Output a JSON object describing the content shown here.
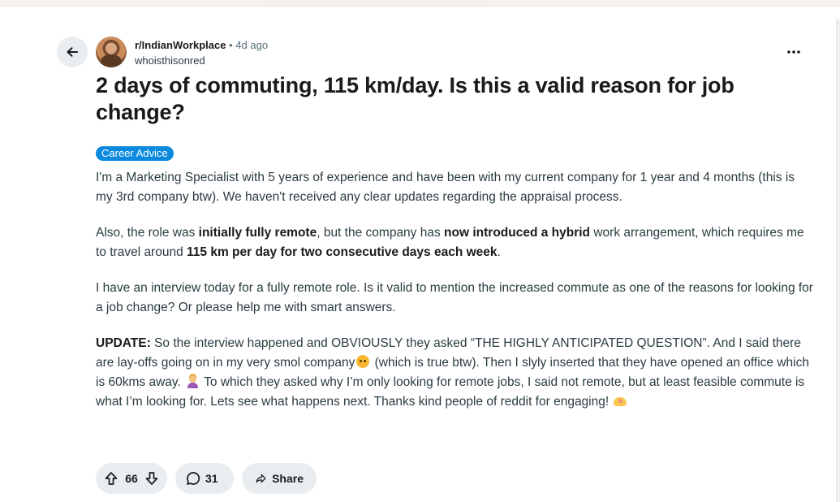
{
  "post": {
    "subreddit": "r/IndianWorkplace",
    "separator": "•",
    "time": "4d ago",
    "author": "whoisthisonred",
    "title": "2 days of commuting, 115 km/day. Is this a valid reason for job change?",
    "flair": "Career Advice",
    "paragraph1": "I'm a Marketing Specialist with 5 years of experience and have been with my current company for 1 year and 4 months (this is my 3rd company btw). We haven't received any clear updates regarding the appraisal process.",
    "paragraph2": {
      "t1": "Also, the role was ",
      "b1": "initially fully remote",
      "t2": ", but the company has ",
      "b2": "now introduced a hybrid",
      "t3": " work arrangement, which requires me to travel around ",
      "b3": "115 km per day for two consecutive days each week",
      "t4": "."
    },
    "paragraph3": "I have an interview today for a fully remote role. Is it valid to mention the increased commute as one of the reasons for looking for a job change? Or please help me with smart answers.",
    "paragraph4": {
      "label": "UPDATE:",
      "t1": " So the interview happened and OBVIOUSLY they asked “THE HIGHLY ANTICIPATED QUESTION”. And I said there are lay-offs going on in my very smol company",
      "t2": " (which is true btw). Then I slyly inserted that they have opened an office which is 60kms away.",
      "t3": " To which they asked why I’m only looking for remote jobs, I said not remote, but at least feasible commute is what I’m looking for. Lets see what happens next. Thanks kind people of reddit for engaging!"
    }
  },
  "actions": {
    "upvotes": "66",
    "comments": "31",
    "share_label": "Share"
  },
  "icons": {
    "back": "arrow-left-icon",
    "more": "more-horizontal-icon",
    "upvote": "arrow-up-icon",
    "downvote": "arrow-down-icon",
    "comment": "speech-bubble-icon",
    "share": "share-arrow-icon"
  },
  "colors": {
    "flair_bg": "#0a8adf",
    "pill_bg": "#e9edf0",
    "text": "#1a1a1b",
    "meta": "#576f76"
  }
}
